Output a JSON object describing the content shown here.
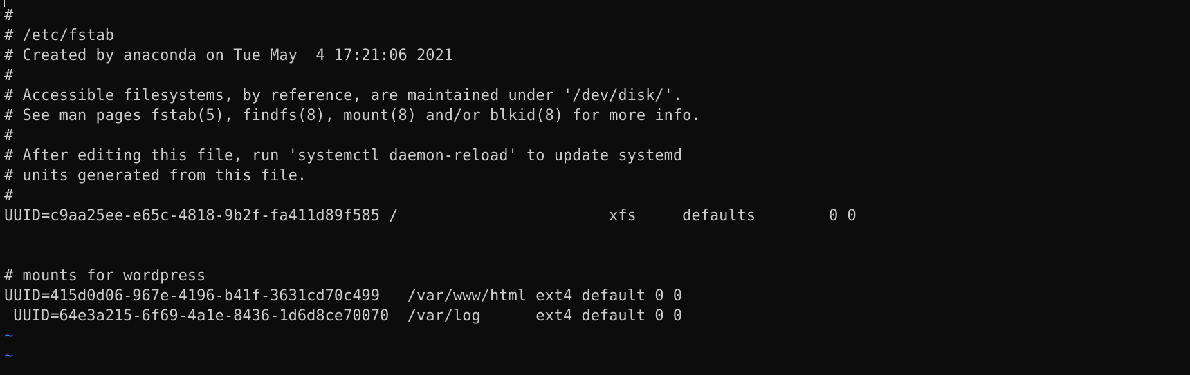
{
  "editor": {
    "lines": [
      "#",
      "# /etc/fstab",
      "# Created by anaconda on Tue May  4 17:21:06 2021",
      "#",
      "# Accessible filesystems, by reference, are maintained under '/dev/disk/'.",
      "# See man pages fstab(5), findfs(8), mount(8) and/or blkid(8) for more info.",
      "#",
      "# After editing this file, run 'systemctl daemon-reload' to update systemd",
      "# units generated from this file.",
      "#",
      "UUID=c9aa25ee-e65c-4818-9b2f-fa411d89f585 /                       xfs     defaults        0 0",
      "",
      "",
      "# mounts for wordpress",
      "UUID=415d0d06-967e-4196-b41f-3631cd70c499   /var/www/html ext4 default 0 0",
      " UUID=64e3a215-6f69-4a1e-8436-1d6d8ce70070  /var/log      ext4 default 0 0"
    ],
    "empty_line_markers": [
      "~",
      "~"
    ]
  },
  "colors": {
    "background": "#0c0c0c",
    "text": "#cccccc",
    "tilde": "#3b78ff"
  }
}
